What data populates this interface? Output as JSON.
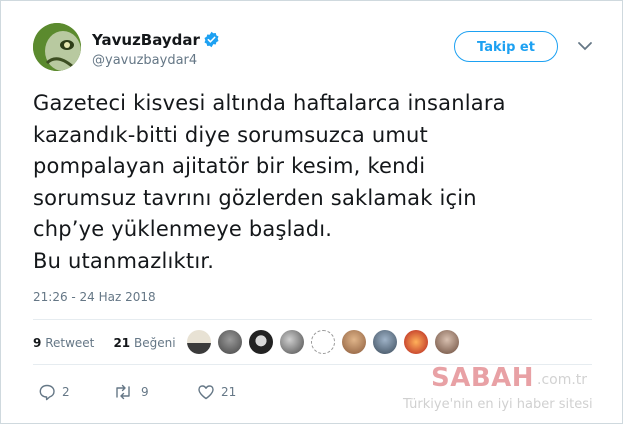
{
  "user": {
    "name": "YavuzBaydar",
    "handle": "@yavuzbaydar4",
    "verified": true,
    "follow_label": "Takip et"
  },
  "tweet": {
    "lines": [
      "Gazeteci kisvesi altında haftalarca insanlara",
      "kazandık-bitti diye sorumsuzca umut",
      "pompalayan ajitatör bir kesim, kendi",
      "sorumsuz tavrını gözlerden saklamak için",
      "chp’ye yüklenmeye başladı.",
      "Bu utanmazlıktır."
    ],
    "timestamp": "21:26 - 24 Haz 2018"
  },
  "stats": {
    "retweet_count": "9",
    "retweet_label": "Retweet",
    "like_count": "21",
    "like_label": "Beğeni"
  },
  "actions": {
    "reply_count": "2",
    "retweet_count": "9",
    "like_count": "21"
  },
  "watermark": {
    "brand": "SABAH",
    "suffix": ".com.tr",
    "tagline": "Türkiye'nin en iyi haber sitesi"
  },
  "colors": {
    "accent": "#1da1f2",
    "text": "#14171a",
    "muted": "#657786"
  }
}
